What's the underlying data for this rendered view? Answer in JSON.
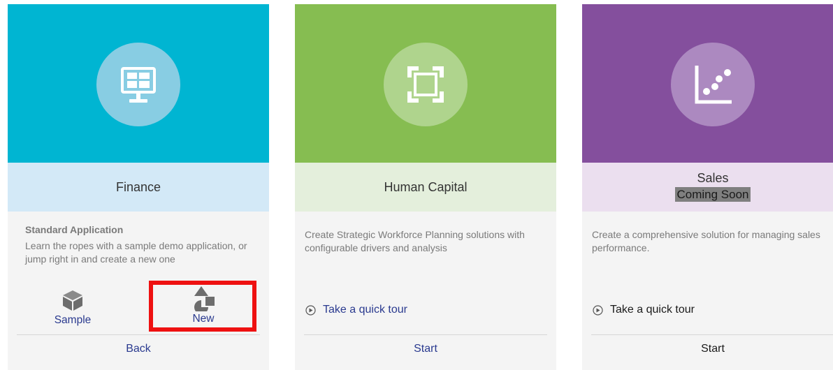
{
  "colors": {
    "finance_hero": "#00b5d2",
    "finance_band": "#d3e9f7",
    "finance_circle": "#88cde3",
    "hc_hero": "#86bd51",
    "hc_band": "#e4efdc",
    "hc_circle": "#afd48d",
    "sales_hero": "#844f9d",
    "sales_band": "#ebdfef",
    "sales_circle": "#ac89c0",
    "link": "#2a3a8f",
    "highlight": "#ee1111"
  },
  "cards": {
    "finance": {
      "icon": "monitor-dashboard-icon",
      "title": "Finance",
      "subtitle": "Standard Application",
      "description": "Learn the ropes with a sample demo application, or jump right in and create a new one",
      "sample_label": "Sample",
      "sample_icon": "cube-icon",
      "new_label": "New",
      "new_icon": "shapes-icon",
      "footer_label": "Back"
    },
    "human_capital": {
      "icon": "focus-square-icon",
      "title": "Human Capital",
      "description": "Create Strategic Workforce Planning solutions with configurable drivers and analysis",
      "tour_label": "Take a quick tour",
      "tour_icon": "play-circle-icon",
      "footer_label": "Start"
    },
    "sales": {
      "icon": "scatter-chart-icon",
      "title": "Sales",
      "badge": "Coming Soon",
      "description": "Create a comprehensive solution for managing sales performance.",
      "tour_label": "Take a quick tour",
      "tour_icon": "play-circle-icon",
      "footer_label": "Start"
    }
  }
}
